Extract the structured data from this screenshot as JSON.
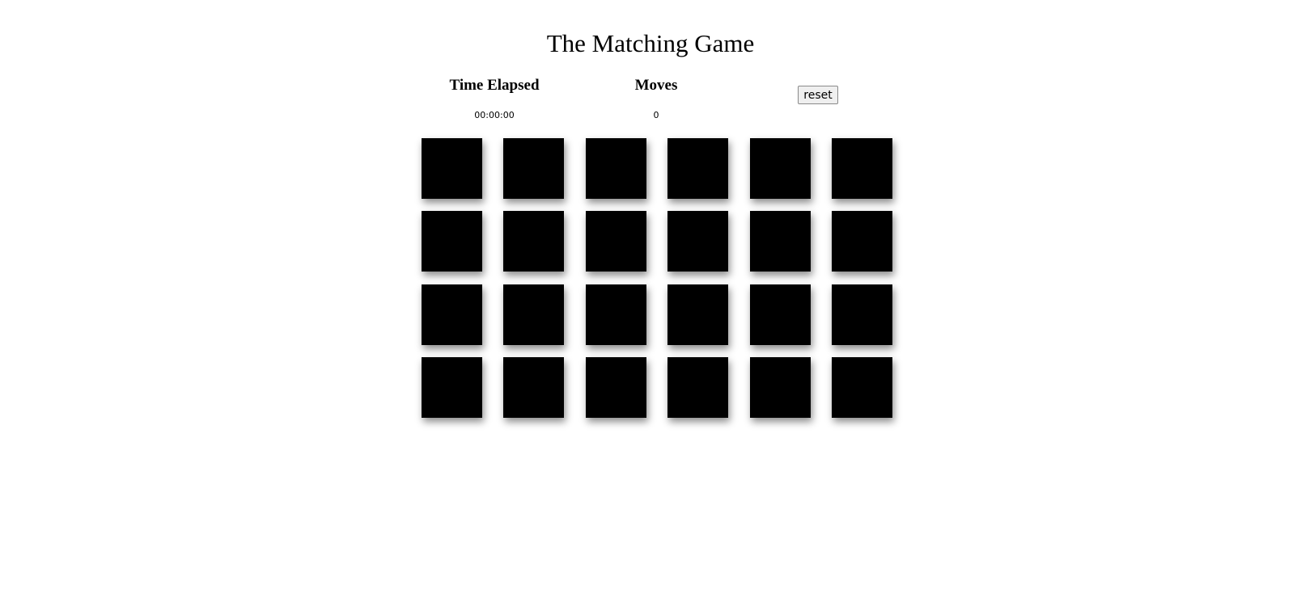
{
  "title": "The Matching Game",
  "stats": {
    "time_label": "Time Elapsed",
    "time_value": "00:00:00",
    "moves_label": "Moves",
    "moves_value": "0"
  },
  "controls": {
    "reset_label": "reset"
  },
  "board": {
    "rows": 4,
    "columns": 6,
    "card_state": "face-down",
    "card_color": "#000000"
  }
}
